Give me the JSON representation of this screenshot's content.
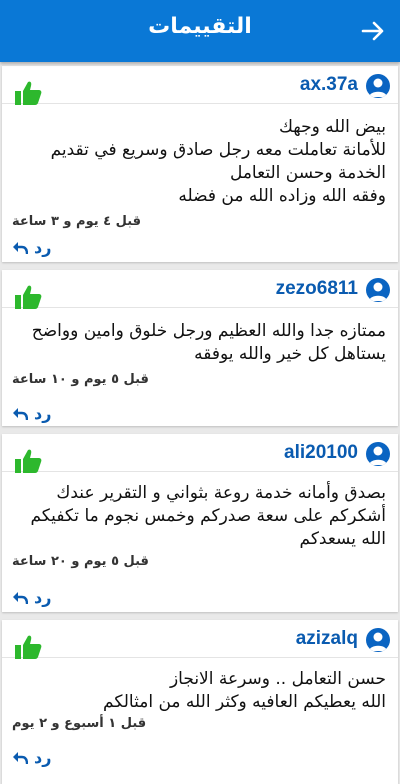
{
  "header": {
    "title": "التقييمات"
  },
  "reviews": [
    {
      "username": "ax.37a",
      "comment": "بيض الله وجهك\nللأمانة تعاملت معه رجل صادق وسريع في تقديم الخدمة وحسن التعامل\nوفقه الله وزاده الله من فضله",
      "time": "قبل ٤ يوم و ٣ ساعة",
      "reply_label": "رد"
    },
    {
      "username": "zezo6811",
      "comment": "ممتازه جدا  والله العظيم ورجل خلوق وامين وواضح يستاهل كل خير والله يوفقه",
      "time": "قبل ٥ يوم و ١٠ ساعة",
      "reply_label": "رد"
    },
    {
      "username": "ali20100",
      "comment": "بصدق وأمانه خدمة روعة بثواني و التقرير عندك أشكركم على سعة صدركم  وخمس نجوم ما تكفيكم الله يسعدكم",
      "time": "قبل ٥ يوم و ٢٠ ساعة",
      "reply_label": "رد"
    },
    {
      "username": "azizalq",
      "comment": "حسن التعامل .. وسرعة الانجاز\nالله يعطيكم العافيه وكثر الله من امثالكم",
      "time": "قبل ١ أسبوع و ٢ يوم",
      "reply_label": "رد"
    }
  ],
  "colors": {
    "appbar": "#0a78d6",
    "accent": "#0a5bb0",
    "like": "#2db82d"
  },
  "icons": {
    "back": "arrow-right-icon",
    "like": "thumbs-up-icon",
    "reply": "reply-arrow-icon",
    "avatar": "user-avatar-icon"
  }
}
